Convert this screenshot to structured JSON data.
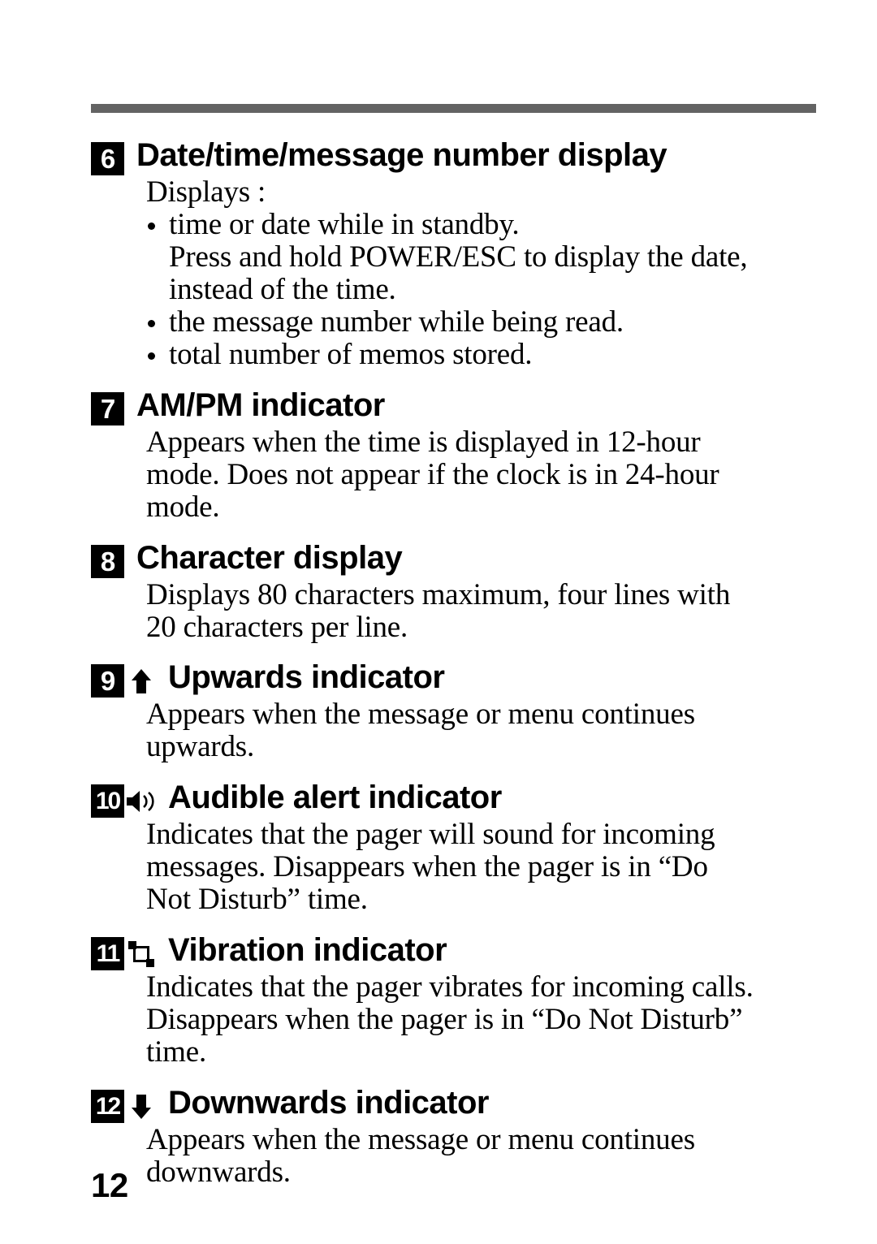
{
  "page": {
    "number": "12",
    "rule_color": "#636363"
  },
  "sections": [
    {
      "badge": "6",
      "icon": null,
      "heading": "Date/time/message number display",
      "lead": "Displays :",
      "bullets": [
        {
          "line1": "time or date while in standby.",
          "line2": "Press and hold POWER/ESC to display the date,",
          "line3": "instead of the time."
        },
        {
          "line1": "the message number while being read."
        },
        {
          "line1": "total number of memos stored."
        }
      ]
    },
    {
      "badge": "7",
      "icon": null,
      "heading": "AM/PM indicator",
      "body_lines": [
        "Appears when the time is displayed in 12-hour",
        "mode. Does not appear if the clock is in 24-hour",
        "mode."
      ]
    },
    {
      "badge": "8",
      "icon": null,
      "heading": "Character display",
      "body_lines": [
        "Displays 80 characters maximum, four  lines with",
        "20 characters per line."
      ]
    },
    {
      "badge": "9",
      "icon": "arrow-up-icon",
      "heading": "Upwards indicator",
      "body_lines": [
        "Appears when the message or menu continues",
        "upwards."
      ]
    },
    {
      "badge": "10",
      "icon": "speaker-icon",
      "heading": "Audible alert indicator",
      "body_lines": [
        "Indicates that the pager will sound for incoming",
        "messages.  Disappears when the pager is in “Do",
        "Not Disturb” time."
      ]
    },
    {
      "badge": "11",
      "icon": "vibration-icon",
      "heading": "Vibration indicator",
      "body_lines": [
        "Indicates that the pager vibrates for incoming calls.",
        "Disappears when the pager is in “Do Not Disturb”",
        "time."
      ]
    },
    {
      "badge": "12",
      "icon": "arrow-down-icon",
      "heading": "Downwards indicator",
      "body_lines": [
        "Appears when the message or menu continues",
        "downwards."
      ]
    }
  ]
}
